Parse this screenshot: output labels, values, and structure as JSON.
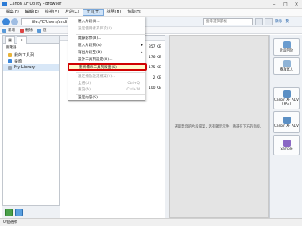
{
  "window": {
    "title": "Canon XF Utility - Browser",
    "minimize": "–",
    "maximize": "□",
    "close": "×"
  },
  "menubar": [
    "檔案(F)",
    "編輯(E)",
    "檢視(V)",
    "片段(C)",
    "工具(T)",
    "說明(H)",
    "協助(H)"
  ],
  "address": {
    "path": "file://C/Users/andi",
    "search_placeholder": "搜尋選擇篩檢"
  },
  "toolbar": {
    "items": [
      "新增",
      "刪除",
      "匯",
      "更新"
    ]
  },
  "tree": {
    "header": "瀏覽器",
    "items": [
      "我的工具列",
      "桌面",
      "My Library"
    ]
  },
  "files": {
    "sizes": [
      "357 KB",
      "176 KB",
      "175 KB",
      "2 KB",
      "100 KB"
    ]
  },
  "preview": {
    "message": "選取影音的片段檔案，若有顯示元件，請選在下方的面板。"
  },
  "rightbar": {
    "header": "顯示一覽",
    "buttons": [
      "片段回放",
      "播放寫入",
      "Canon XF ADV (FAE)",
      "Canon XF ADV",
      "Sample"
    ]
  },
  "status": {
    "text": "0 個選項"
  },
  "dropdown": {
    "items": [
      {
        "label": "匯入片段(I)...",
        "disabled": false
      },
      {
        "label": "設定使用者為目次(L)...",
        "disabled": true
      },
      {
        "label": "燒錄影像(B)...",
        "disabled": false
      },
      {
        "label": "匯入片段到(A)",
        "disabled": false,
        "arrow": "▸"
      },
      {
        "label": "寫出片段至(D)",
        "disabled": false,
        "arrow": "▸"
      },
      {
        "label": "設計工具列設定(H)...",
        "disabled": false
      },
      {
        "label": "重新標示工具列版面(K)",
        "disabled": false,
        "highlight": true
      },
      {
        "label": "設定播放設定檔案(Y)...",
        "disabled": true
      },
      {
        "label": "全選(U)",
        "disabled": true,
        "shortcut": "Ctrl+Q"
      },
      {
        "label": "重設(A)",
        "disabled": true,
        "shortcut": "Ctrl+W"
      },
      {
        "label": "設定內容(S)...",
        "disabled": false
      }
    ]
  }
}
